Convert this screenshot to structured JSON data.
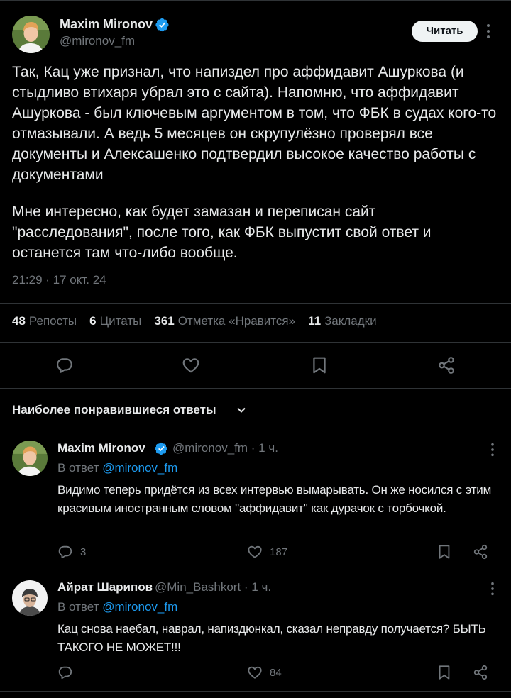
{
  "main_tweet": {
    "author_name": "Maxim Mironov",
    "handle": "@mironov_fm",
    "follow_label": "Читать",
    "paragraph_1": "Так, Кац уже признал, что напиздел про аффидавит Ашуркова (и стыдливо втихаря убрал это с сайта). Напомню, что аффидавит Ашуркова - был ключевым аргументом в том, что ФБК в судах кого-то отмазывали. А ведь 5 месяцев он скрупулёзно проверял все документы и Алексашенко подтвердил высокое качество работы с документами",
    "paragraph_2": "Мне интересно, как будет замазан и переписан сайт \"расследования\", после того, как ФБК выпустит свой ответ и останется там что-либо вообще.",
    "timestamp": "21:29 · 17 окт. 24",
    "stats": {
      "reposts_count": "48",
      "reposts_label": "Репосты",
      "quotes_count": "6",
      "quotes_label": "Цитаты",
      "likes_count": "361",
      "likes_label": "Отметка «Нравится»",
      "bookmarks_count": "11",
      "bookmarks_label": "Закладки"
    }
  },
  "replies_header": "Наиболее понравившиеся ответы",
  "replies": [
    {
      "author_name": "Maxim Mironov",
      "handle_time": "@mironov_fm · 1 ч.",
      "reply_prefix": "В ответ",
      "reply_to": "@mironov_fm",
      "text": "Видимо теперь придётся из всех интервью вымарывать. Он же носился с этим красивым иностранным словом \"аффидавит\" как дурачок с торбочкой.",
      "reply_count": "3",
      "like_count": "187"
    },
    {
      "author_name": "Айрат Шарипов",
      "handle_time": "@Min_Bashkort · 1 ч.",
      "reply_prefix": "В ответ",
      "reply_to": "@mironov_fm",
      "text": "Кац снова наебал, наврал, напиздюнкал, сказал неправду получается? БЫТЬ ТАКОГО НЕ МОЖЕТ!!!",
      "reply_count": "",
      "like_count": "84"
    }
  ],
  "colors": {
    "background": "#000000",
    "text": "#e7e9ea",
    "secondary": "#71767b",
    "link": "#1d9bf0",
    "divider": "#2f3336",
    "verified": "#1d9bf0"
  },
  "icons": [
    "verified-badge-icon",
    "more-icon",
    "reply-icon",
    "like-icon",
    "bookmark-icon",
    "share-icon",
    "chevron-down-icon"
  ]
}
